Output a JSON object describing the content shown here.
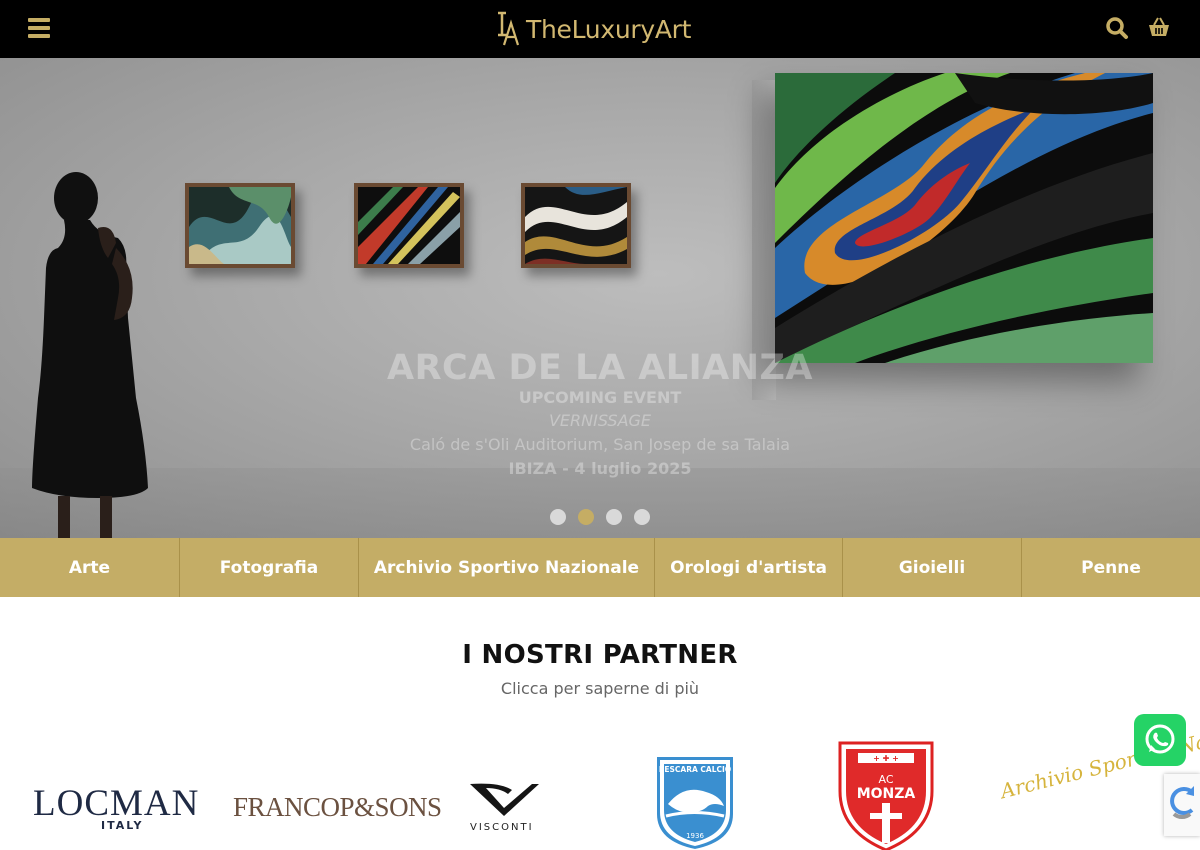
{
  "header": {
    "logo_text": "TheLuxuryArt",
    "icons": [
      "menu-icon",
      "search-icon",
      "cart-icon"
    ],
    "accent_color": "#c5ad64"
  },
  "hero": {
    "title": "ARCA DE LA ALIANZA",
    "subtitle": "UPCOMING EVENT",
    "event_type": "VERNISSAGE",
    "location": "Caló de s'Oli Auditorium, San Josep de sa Talaia",
    "date": "IBIZA - 4 luglio 2025",
    "slides": 4,
    "active_slide": 2
  },
  "categories": [
    {
      "label": "Arte"
    },
    {
      "label": "Fotografia"
    },
    {
      "label": "Archivio Sportivo Nazionale"
    },
    {
      "label": "Orologi d'artista"
    },
    {
      "label": "Gioielli"
    },
    {
      "label": "Penne"
    }
  ],
  "partners": {
    "title": "I NOSTRI PARTNER",
    "subtitle": "Clicca per saperne di più",
    "logos": {
      "locman": "LOCMAN",
      "locman_sub": "ITALY",
      "franco": "FRANCOP&SONS",
      "visconti": "VISCONTI",
      "pescara": "PESCARA CALCIO",
      "pescara_year": "1936",
      "monza_ac": "AC",
      "monza": "MONZA",
      "asn": "Archivio Sportivo Nazionale"
    }
  },
  "widgets": {
    "whatsapp_icon": "whatsapp-icon",
    "recaptcha_icon": "recaptcha-icon"
  }
}
